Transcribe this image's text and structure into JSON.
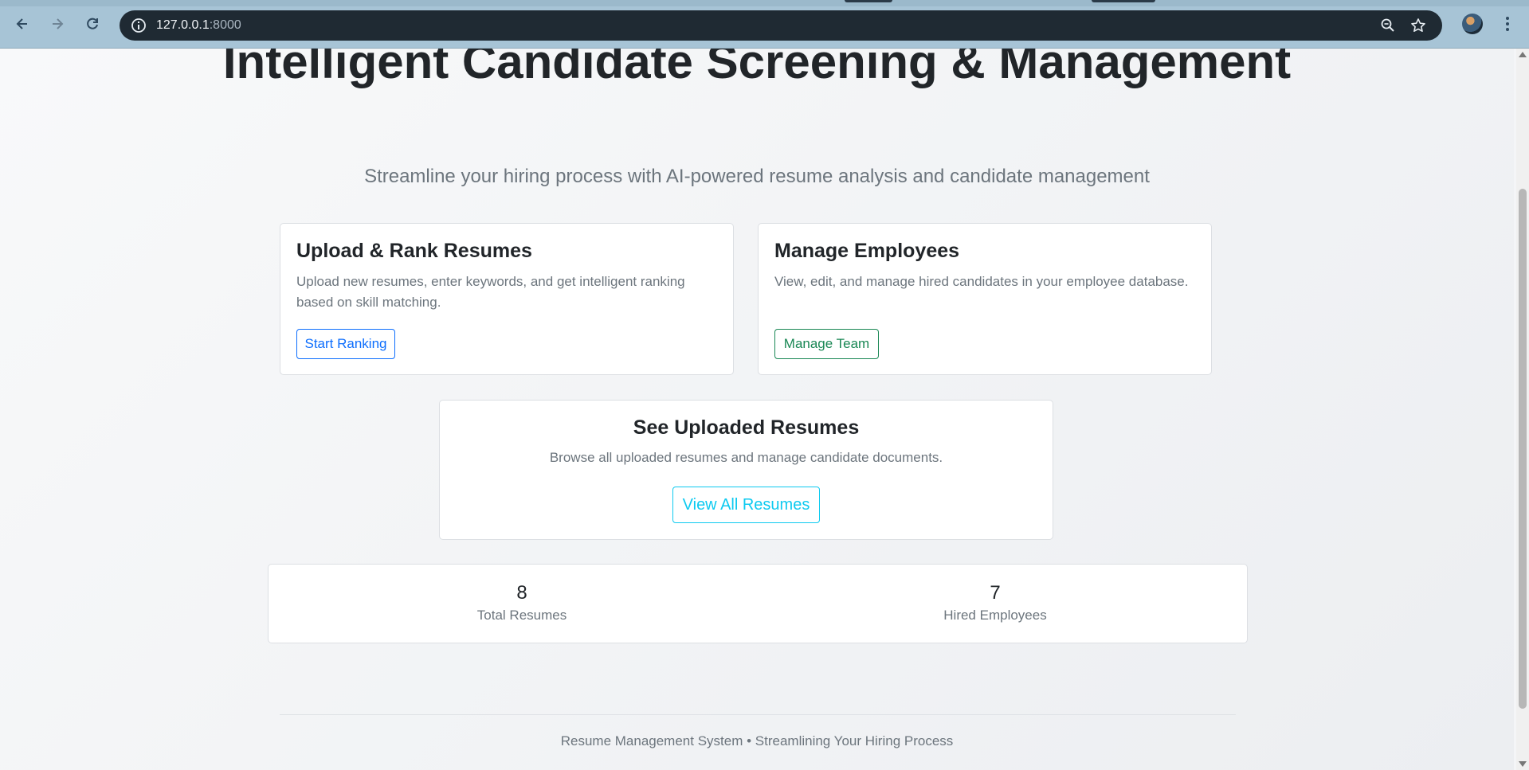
{
  "browser": {
    "url_host": "127.0.0.1",
    "url_port": ":8000"
  },
  "hero": {
    "title": "Intelligent Candidate Screening & Management",
    "subtitle": "Streamline your hiring process with AI-powered resume analysis and candidate management"
  },
  "cards": {
    "upload": {
      "title": "Upload & Rank Resumes",
      "description": "Upload new resumes, enter keywords, and get intelligent ranking based on skill matching.",
      "button": "Start Ranking"
    },
    "employees": {
      "title": "Manage Employees",
      "description": "View, edit, and manage hired candidates in your employee database.",
      "button": "Manage Team"
    },
    "resumes": {
      "title": "See Uploaded Resumes",
      "description": "Browse all uploaded resumes and manage candidate documents.",
      "button": "View All Resumes"
    }
  },
  "stats": {
    "total_resumes": {
      "value": "8",
      "label": "Total Resumes"
    },
    "hired_employees": {
      "value": "7",
      "label": "Hired Employees"
    }
  },
  "footer": {
    "text": "Resume Management System • Streamlining Your Hiring Process"
  },
  "colors": {
    "primary": "#0d6efd",
    "success": "#198754",
    "info": "#0dcaf0"
  },
  "icons": [
    "back-icon",
    "forward-icon",
    "reload-icon",
    "info-icon",
    "zoom-icon",
    "star-icon",
    "kebab-menu-icon"
  ]
}
